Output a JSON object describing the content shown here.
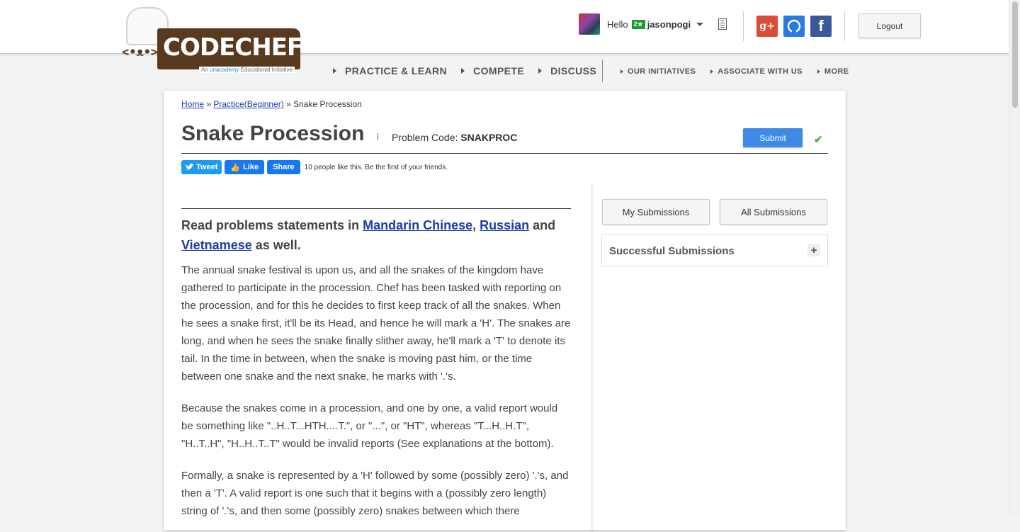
{
  "header": {
    "logo_text": "CODECHEF",
    "logo_face": "<•ᴥ•>",
    "logo_tagline_prefix": "An ",
    "logo_tagline_brand": "unacademy",
    "logo_tagline_suffix": " Educational Initiative",
    "nav": [
      "PRACTICE & LEARN",
      "COMPETE",
      "DISCUSS"
    ],
    "sub_nav": [
      "OUR INITIATIVES",
      "ASSOCIATE WITH US",
      "MORE"
    ],
    "greeting": "Hello",
    "rating_badge": "2★",
    "username": "jasonpogi",
    "logout_label": "Logout",
    "social": {
      "gplus": "g+",
      "github": "◐",
      "facebook": "f"
    }
  },
  "breadcrumb": {
    "home": "Home",
    "sep1": " » ",
    "practice": "Practice(Beginner)",
    "sep2": " » ",
    "current": "Snake Procession"
  },
  "problem": {
    "title": "Snake Procession",
    "code_label": "Problem Code: ",
    "code": "SNAKPROC",
    "submit_label": "Submit",
    "solved_mark": "✔"
  },
  "share": {
    "tweet": "Tweet",
    "like": "Like",
    "share": "Share",
    "like_text": "10 people like this. Be the first of your friends."
  },
  "statement": {
    "lang_prefix": "Read problems statements in ",
    "lang1": "Mandarin Chinese",
    "lang_sep": ", ",
    "lang2": "Russian",
    "lang_and": " and ",
    "lang3": "Vietnamese",
    "lang_suffix": " as well.",
    "paragraphs": [
      "The annual snake festival is upon us, and all the snakes of the kingdom have gathered to participate in the procession. Chef has been tasked with reporting on the procession, and for this he decides to first keep track of all the snakes. When he sees a snake first, it'll be its Head, and hence he will mark a 'H'. The snakes are long, and when he sees the snake finally slither away, he'll mark a 'T' to denote its tail. In the time in between, when the snake is moving past him, or the time between one snake and the next snake, he marks with '.'s.",
      "Because the snakes come in a procession, and one by one, a valid report would be something like \"..H..T...HTH....T.\", or \"...\", or \"HT\", whereas \"T...H..H.T\", \"H..T..H\", \"H..H..T..T\" would be invalid reports (See explanations at the bottom).",
      "Formally, a snake is represented by a 'H' followed by some (possibly zero) '.'s, and then a 'T'. A valid report is one such that it begins with a (possibly zero length) string of '.'s, and then some (possibly zero) snakes between which there"
    ]
  },
  "sidebar": {
    "my_submissions": "My Submissions",
    "all_submissions": "All Submissions",
    "successful_submissions": "Successful Submissions",
    "expand": "+"
  }
}
